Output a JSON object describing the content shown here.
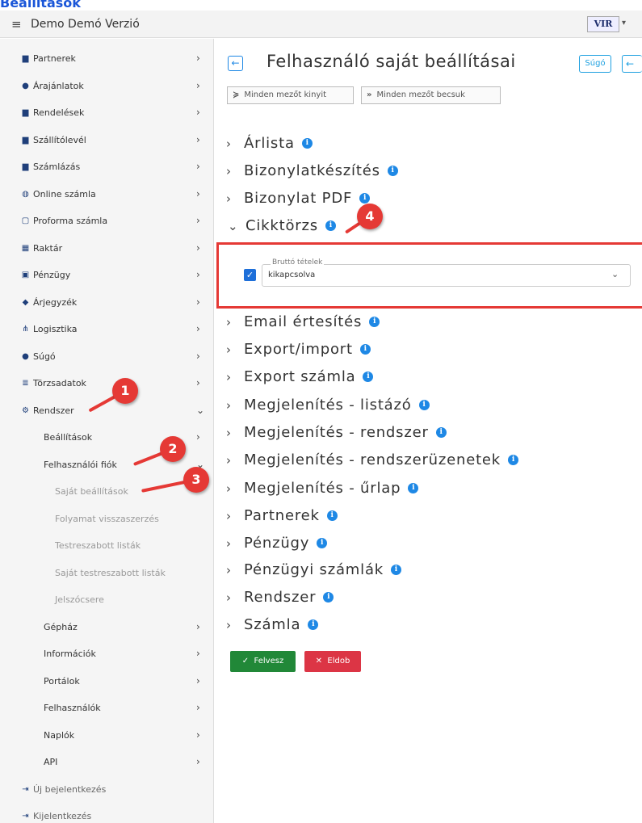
{
  "page_heading": "Beállítások",
  "topbar": {
    "app_name": "Demo Demó Verzió",
    "logo_text": "VIR",
    "logo_caret": "▾"
  },
  "sidebar": {
    "items": [
      {
        "label": "Partnerek",
        "icon": "building-icon"
      },
      {
        "label": "Árajánlatok",
        "icon": "users-icon"
      },
      {
        "label": "Rendelések",
        "icon": "order-icon"
      },
      {
        "label": "Szállítólevél",
        "icon": "delivery-icon"
      },
      {
        "label": "Számlázás",
        "icon": "invoice-icon"
      },
      {
        "label": "Online számla",
        "icon": "globe-icon"
      },
      {
        "label": "Proforma számla",
        "icon": "proforma-icon"
      },
      {
        "label": "Raktár",
        "icon": "warehouse-icon"
      },
      {
        "label": "Pénzügy",
        "icon": "money-icon"
      },
      {
        "label": "Árjegyzék",
        "icon": "tag-icon"
      },
      {
        "label": "Logisztika",
        "icon": "logistics-icon"
      },
      {
        "label": "Súgó",
        "icon": "help-icon"
      },
      {
        "label": "Törzsadatok",
        "icon": "database-icon"
      },
      {
        "label": "Rendszer",
        "icon": "cogs-icon"
      }
    ],
    "rendszer_children": [
      {
        "label": "Beállítások"
      },
      {
        "label": "Felhasználói fiók"
      }
    ],
    "fiok_children": [
      {
        "label": "Saját beállítások"
      },
      {
        "label": "Folyamat visszaszerzés"
      },
      {
        "label": "Testreszabott listák"
      },
      {
        "label": "Saját testreszabott listák"
      },
      {
        "label": "Jelszócsere"
      }
    ],
    "rendszer_more": [
      {
        "label": "Gépház"
      },
      {
        "label": "Információk"
      },
      {
        "label": "Portálok"
      },
      {
        "label": "Felhasználók"
      },
      {
        "label": "Naplók"
      },
      {
        "label": "API"
      }
    ],
    "footer": [
      {
        "label": "Új bejelentkezés",
        "icon": "login-icon"
      },
      {
        "label": "Kijelentkezés",
        "icon": "logout-icon"
      }
    ]
  },
  "main": {
    "title": "Felhasználó saját beállításai",
    "help_label": "Súgó",
    "expand_all": "Minden mezőt kinyit",
    "collapse_all": "Minden mezőt becsuk",
    "sections": [
      "Árlista",
      "Bizonylatkészítés",
      "Bizonylat PDF",
      "Cikktörzs",
      "Email értesítés",
      "Export/import",
      "Export számla",
      "Megjelenítés - listázó",
      "Megjelenítés - rendszer",
      "Megjelenítés - rendszerüzenetek",
      "Megjelenítés - űrlap",
      "Partnerek",
      "Pénzügy",
      "Pénzügyi számlák",
      "Rendszer",
      "Számla"
    ],
    "field": {
      "label": "Bruttó tételek",
      "value": "kikapcsolva",
      "checked": true
    },
    "save_label": "Felvesz",
    "discard_label": "Eldob"
  },
  "markers": [
    "1",
    "2",
    "3",
    "4"
  ],
  "colors": {
    "accent": "#1e88e5",
    "highlight": "#e53935",
    "save": "#218838",
    "discard": "#dc3545"
  }
}
